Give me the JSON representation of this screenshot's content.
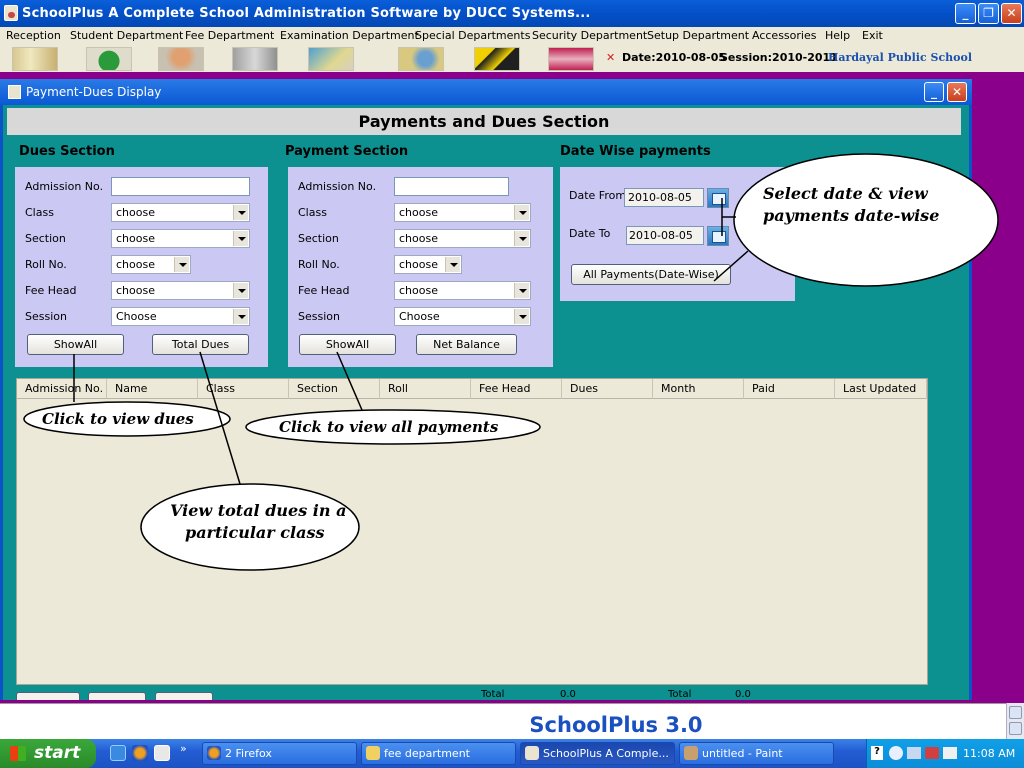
{
  "app": {
    "title": "SchoolPlus   A Complete School Administration Software by DUCC Systems...",
    "menu": [
      "Reception",
      "Student Department",
      "Fee Department",
      "Examination Department",
      "Special  Departments",
      "Security Department",
      "Setup Department",
      "Accessories",
      "Help",
      "Exit"
    ],
    "status_date": "Date:2010-08-05",
    "status_session": "Session:2010-2011",
    "status_school": "Hardayal Public School"
  },
  "window": {
    "title": "Payment-Dues Display",
    "header": "Payments and Dues Section"
  },
  "dues": {
    "title": "Dues Section",
    "labels": [
      "Admission No.",
      "Class",
      "Section",
      "Roll No.",
      "Fee Head",
      "Session"
    ],
    "admission_value": "",
    "class_value": "choose",
    "section_value": "choose",
    "roll_value": "choose",
    "feehead_value": "choose",
    "session_value": "Choose",
    "showall_label": "ShowAll",
    "totaldues_label": "Total Dues"
  },
  "payment": {
    "title": "Payment Section",
    "labels": [
      "Admission No.",
      "Class",
      "Section",
      "Roll No.",
      "Fee Head",
      "Session"
    ],
    "admission_value": "",
    "class_value": "choose",
    "section_value": "choose",
    "roll_value": "choose",
    "feehead_value": "choose",
    "session_value": "Choose",
    "showall_label": "ShowAll",
    "netbalance_label": "Net Balance"
  },
  "datewise": {
    "title": "Date Wise payments",
    "from_label": "Date From",
    "from_value": "2010-08-05",
    "to_label": "Date To",
    "to_value": "2010-08-05",
    "allpayments_label": "All Payments(Date-Wise)"
  },
  "table": {
    "columns": [
      "Admission No.",
      "Name",
      "Class",
      "Section",
      "Roll",
      "Fee Head",
      "Dues",
      "Month",
      "Paid",
      "Last Updated"
    ]
  },
  "bottom": {
    "total1_label": "Total",
    "total1_value": "0.0",
    "total2_label": "Total",
    "total2_value": "0.0"
  },
  "status": {
    "version": "SchoolPlus 3.0"
  },
  "taskbar": {
    "start": "start",
    "tasks": [
      "2 Firefox",
      "fee department",
      "SchoolPlus   A Comple...",
      "untitled - Paint"
    ],
    "clock": "11:08 AM"
  },
  "annotations": {
    "view_dues": "Click to view dues",
    "view_payments": "Click to view all payments",
    "total_dues_line1": "View total dues in a",
    "total_dues_line2": "particular class",
    "datewise_line1": "Select date & view",
    "datewise_line2": "payments date-wise"
  },
  "colors": {
    "window_bg": "#0d9190",
    "panel_bg": "#ccc8f4",
    "desktop": "#8b008b",
    "titlebar": "#0a5fd8"
  }
}
